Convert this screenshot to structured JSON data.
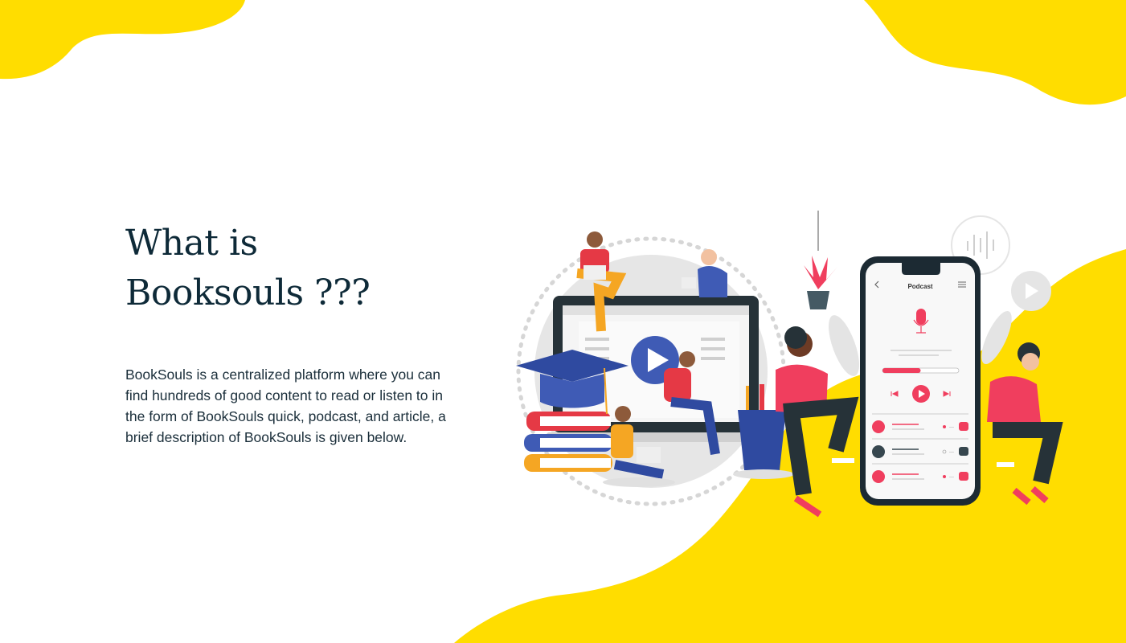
{
  "page": {
    "heading_line1": "What is",
    "heading_line2": "Booksouls ???",
    "description": "BookSouls is a centralized platform where you can find hundreds of good content to read or listen to in the form of BookSouls quick, podcast, and article, a brief description of BookSouls is given below."
  },
  "illustration": {
    "phone_title": "Podcast",
    "podcast_progress": 0.5
  },
  "colors": {
    "accent_yellow": "#FFDD00",
    "text_dark": "#0e2a38",
    "podcast_red": "#F03E5E",
    "phone_frame": "#1c2a33"
  }
}
